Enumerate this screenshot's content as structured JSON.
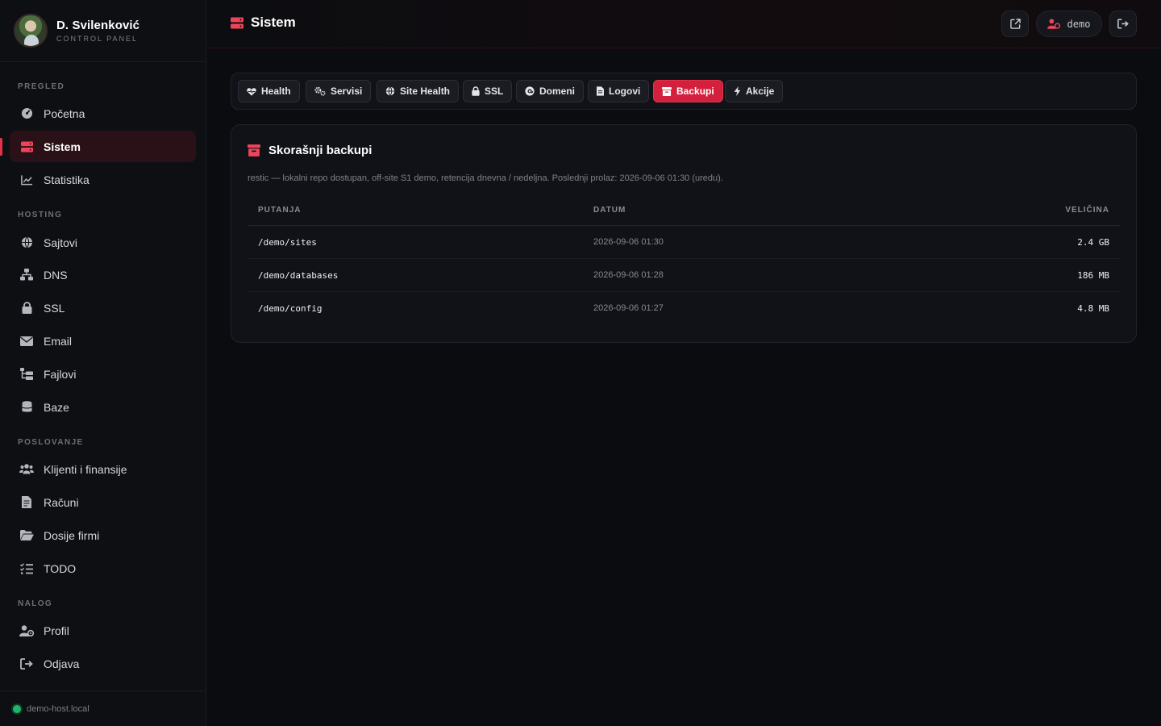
{
  "brand": {
    "name": "D. Svilenković",
    "subtitle": "CONTROL PANEL"
  },
  "sidebar": {
    "sections": [
      {
        "label": "PREGLED"
      },
      {
        "label": "HOSTING"
      },
      {
        "label": "POSLOVANJE"
      },
      {
        "label": "NALOG"
      }
    ],
    "items": [
      {
        "label": "Početna",
        "icon": "dashboard-icon"
      },
      {
        "label": "Sistem",
        "icon": "server-icon",
        "active": true
      },
      {
        "label": "Statistika",
        "icon": "chart-line-icon"
      },
      {
        "label": "Sajtovi",
        "icon": "globe-icon"
      },
      {
        "label": "DNS",
        "icon": "network-icon"
      },
      {
        "label": "SSL",
        "icon": "lock-icon"
      },
      {
        "label": "Email",
        "icon": "envelope-icon"
      },
      {
        "label": "Fajlovi",
        "icon": "folder-tree-icon"
      },
      {
        "label": "Baze",
        "icon": "database-icon"
      },
      {
        "label": "Klijenti i finansije",
        "icon": "users-icon"
      },
      {
        "label": "Računi",
        "icon": "invoice-icon"
      },
      {
        "label": "Dosije firmi",
        "icon": "folder-open-icon"
      },
      {
        "label": "TODO",
        "icon": "list-check-icon"
      },
      {
        "label": "Profil",
        "icon": "user-gear-icon"
      },
      {
        "label": "Odjava",
        "icon": "logout-icon"
      }
    ],
    "footer": {
      "host": "demo-host.local",
      "status_color": "#21b46a"
    }
  },
  "header": {
    "title": "Sistem",
    "user": "demo"
  },
  "tabs": [
    {
      "label": "Health",
      "icon": "heart-pulse-icon"
    },
    {
      "label": "Servisi",
      "icon": "gears-icon"
    },
    {
      "label": "Site Health",
      "icon": "globe-icon"
    },
    {
      "label": "SSL",
      "icon": "lock-icon"
    },
    {
      "label": "Domeni",
      "icon": "at-icon"
    },
    {
      "label": "Logovi",
      "icon": "file-icon"
    },
    {
      "label": "Backupi",
      "icon": "archive-icon",
      "active": true
    },
    {
      "label": "Akcije",
      "icon": "bolt-icon"
    }
  ],
  "backups": {
    "title": "Skorašnji backupi",
    "description": "restic — lokalni repo dostupan, off-site S1 demo, retencija dnevna / nedeljna. Poslednji prolaz: 2026-09-06 01:30 (uredu).",
    "columns": [
      "PUTANJA",
      "DATUM",
      "VELIČINA"
    ],
    "rows": [
      {
        "path": "/demo/sites",
        "date": "2026-09-06 01:30",
        "size": "2.4 GB"
      },
      {
        "path": "/demo/databases",
        "date": "2026-09-06 01:28",
        "size": "186 MB"
      },
      {
        "path": "/demo/config",
        "date": "2026-09-06 01:27",
        "size": "4.8 MB"
      }
    ]
  },
  "colors": {
    "accent": "#e8304a",
    "background": "#0b0c10",
    "panel": "#111217"
  }
}
